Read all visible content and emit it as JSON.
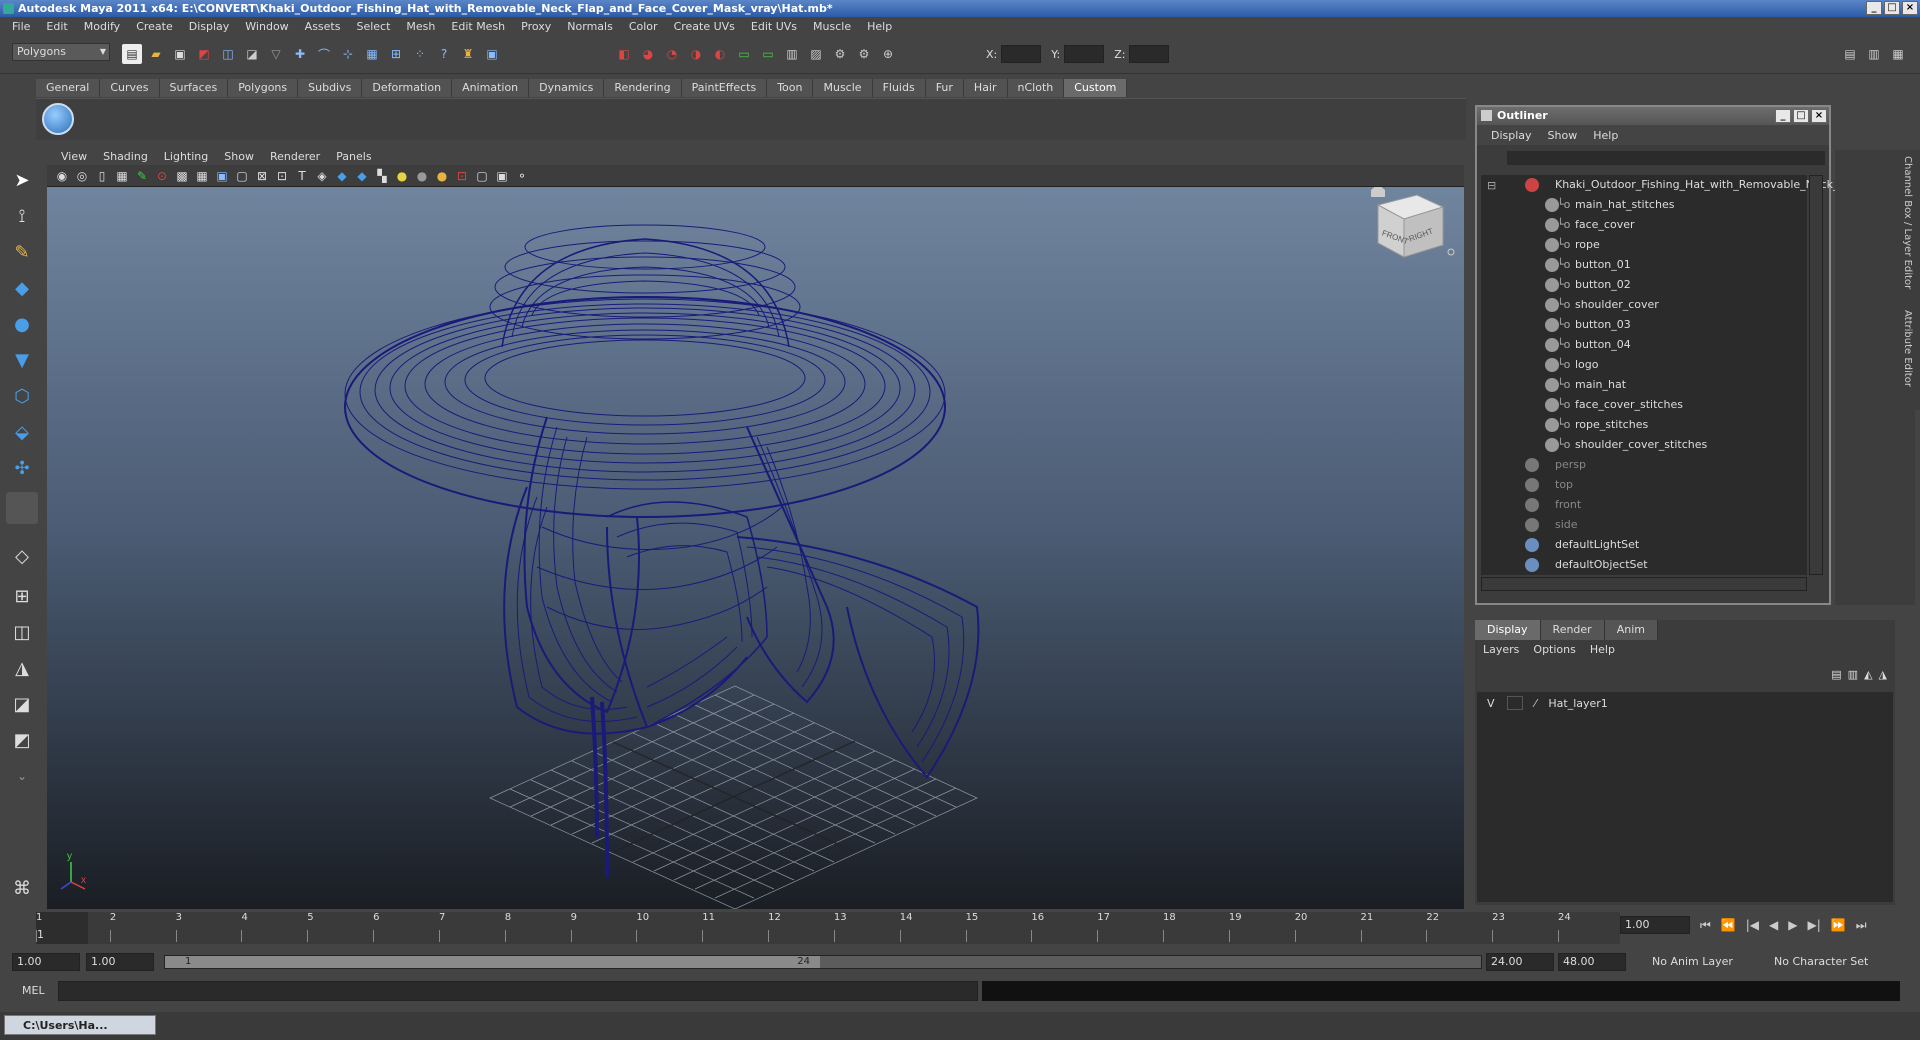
{
  "window": {
    "title": "Autodesk Maya 2011 x64: E:\\CONVERT\\Khaki_Outdoor_Fishing_Hat_with_Removable_Neck_Flap_and_Face_Cover_Mask_vray\\Hat.mb*"
  },
  "menubar": [
    "File",
    "Edit",
    "Modify",
    "Create",
    "Display",
    "Window",
    "Assets",
    "Select",
    "Mesh",
    "Edit Mesh",
    "Proxy",
    "Normals",
    "Color",
    "Create UVs",
    "Edit UVs",
    "Muscle",
    "Help"
  ],
  "statusline": {
    "mode": "Polygons",
    "x_label": "X:",
    "y_label": "Y:",
    "z_label": "Z:"
  },
  "shelf": {
    "tabs": [
      "General",
      "Curves",
      "Surfaces",
      "Polygons",
      "Subdivs",
      "Deformation",
      "Animation",
      "Dynamics",
      "Rendering",
      "PaintEffects",
      "Toon",
      "Muscle",
      "Fluids",
      "Fur",
      "Hair",
      "nCloth",
      "Custom"
    ],
    "active": "Custom"
  },
  "viewport": {
    "menu": [
      "View",
      "Shading",
      "Lighting",
      "Show",
      "Renderer",
      "Panels"
    ],
    "viewcube": {
      "front": "FRONT",
      "right": "RIGHT"
    },
    "axis": {
      "x": "x",
      "y": "y"
    },
    "wire_color": "#1a1a7a"
  },
  "outliner": {
    "title": "Outliner",
    "menu": [
      "Display",
      "Show",
      "Help"
    ],
    "root": "Khaki_Outdoor_Fishing_Hat_with_Removable_Neck_I",
    "children": [
      "main_hat_stitches",
      "face_cover",
      "rope",
      "button_01",
      "button_02",
      "shoulder_cover",
      "button_03",
      "button_04",
      "logo",
      "main_hat",
      "face_cover_stitches",
      "rope_stitches",
      "shoulder_cover_stitches"
    ],
    "cameras": [
      "persp",
      "top",
      "front",
      "side"
    ],
    "sets": [
      "defaultLightSet",
      "defaultObjectSet"
    ]
  },
  "layers": {
    "tabs": [
      "Display",
      "Render",
      "Anim"
    ],
    "active_tab": "Display",
    "menu": [
      "Layers",
      "Options",
      "Help"
    ],
    "items": [
      {
        "visible": "V",
        "name": "Hat_layer1"
      }
    ]
  },
  "channelbox": {
    "tab1": "Channel Box / Layer Editor",
    "tab2": "Attribute Editor"
  },
  "timeline": {
    "ticks": [
      "1",
      "2",
      "3",
      "4",
      "5",
      "6",
      "7",
      "8",
      "9",
      "10",
      "11",
      "12",
      "13",
      "14",
      "15",
      "16",
      "17",
      "18",
      "19",
      "20",
      "21",
      "22",
      "23",
      "24"
    ],
    "current_frame": "1.00",
    "playhead": "1"
  },
  "range": {
    "start": "1.00",
    "anim_start": "1.00",
    "thumb_start": "1",
    "thumb_end": "24",
    "end": "24.00",
    "anim_end": "48.00",
    "anim_layer": "No Anim Layer",
    "char_set": "No Character Set"
  },
  "cmdline": {
    "label": "MEL"
  },
  "taskbar": {
    "item": "C:\\Users\\Ha..."
  }
}
